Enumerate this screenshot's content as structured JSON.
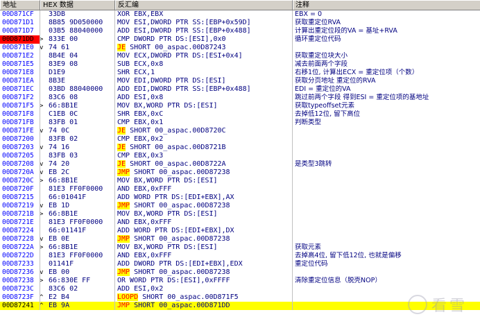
{
  "header": {
    "address": "地址",
    "hex": "HEX 数据",
    "disasm": "反汇编",
    "comment": "注释"
  },
  "watermark": "看雪",
  "colors": {
    "current_addr_bg": "#ff0000",
    "selected_bg": "#ffff00",
    "jump_highlight": "#ffff00",
    "jump_text": "#ff0000",
    "text": "#000080",
    "address": "#0000ff"
  },
  "rows": [
    {
      "addr": "00D871CF",
      "mark": "",
      "hex": "33DB",
      "mn": "",
      "ops": "XOR EBX,EBX",
      "cmt": "EBX = 0"
    },
    {
      "addr": "00D871D1",
      "mark": "",
      "hex": "8B85 9D050000",
      "mn": "",
      "ops": "MOV ESI,DWORD PTR SS:[EBP+0x59D]",
      "cmt": "获取重定位RVA"
    },
    {
      "addr": "00D871D7",
      "mark": "",
      "hex": "03B5 88040000",
      "mn": "",
      "ops": "ADD ESI,DWORD PTR SS:[EBP+0x488]",
      "cmt": "计算出重定位段的VA = 基址+RVA"
    },
    {
      "addr": "00D871DD",
      "mark": ">",
      "hex": "833E 00",
      "mn": "",
      "ops": "CMP DWORD PTR DS:[ESI],0x0",
      "cmt": "循环重定位代码"
    },
    {
      "addr": "00D871E0",
      "mark": "v",
      "hex": "74 61",
      "mn": "JE",
      "ops": "SHORT 00_aspac.00D87243",
      "cmt": ""
    },
    {
      "addr": "00D871E2",
      "mark": "",
      "hex": "8B4E 04",
      "mn": "",
      "ops": "MOV ECX,DWORD PTR DS:[ESI+0x4]",
      "cmt": "获取重定位块大小"
    },
    {
      "addr": "00D871E5",
      "mark": "",
      "hex": "83E9 08",
      "mn": "",
      "ops": "SUB ECX,0x8",
      "cmt": "减去前面两个字段"
    },
    {
      "addr": "00D871E8",
      "mark": "",
      "hex": "D1E9",
      "mn": "",
      "ops": "SHR ECX,1",
      "cmt": "右移1位, 计算出ECX = 重定位项（个数）"
    },
    {
      "addr": "00D871EA",
      "mark": "",
      "hex": "8B3E",
      "mn": "",
      "ops": "MOV EDI,DWORD PTR DS:[ESI]",
      "cmt": "获取分页地址  重定位的RVA"
    },
    {
      "addr": "00D871EC",
      "mark": "",
      "hex": "03BD 88040000",
      "mn": "",
      "ops": "ADD EDI,DWORD PTR SS:[EBP+0x488]",
      "cmt": "EDI = 重定位的VA"
    },
    {
      "addr": "00D871F2",
      "mark": "",
      "hex": "83C6 08",
      "mn": "",
      "ops": "ADD ESI,0x8",
      "cmt": "跳过前两个字段 得到ESI = 重定位项的基地址"
    },
    {
      "addr": "00D871F5",
      "mark": ">",
      "hex": "66:8B1E",
      "mn": "",
      "ops": "MOV BX,WORD PTR DS:[ESI]",
      "cmt": "获取typeoffset元素"
    },
    {
      "addr": "00D871F8",
      "mark": "",
      "hex": "C1EB 0C",
      "mn": "",
      "ops": "SHR EBX,0xC",
      "cmt": "去掉低12位, 留下高位"
    },
    {
      "addr": "00D871FB",
      "mark": "",
      "hex": "83FB 01",
      "mn": "",
      "ops": "CMP EBX,0x1",
      "cmt": "判断类型"
    },
    {
      "addr": "00D871FE",
      "mark": "v",
      "hex": "74 0C",
      "mn": "JE",
      "ops": "SHORT 00_aspac.00D8720C",
      "cmt": ""
    },
    {
      "addr": "00D87200",
      "mark": "",
      "hex": "83FB 02",
      "mn": "",
      "ops": "CMP EBX,0x2",
      "cmt": ""
    },
    {
      "addr": "00D87203",
      "mark": "v",
      "hex": "74 16",
      "mn": "JE",
      "ops": "SHORT 00_aspac.00D8721B",
      "cmt": ""
    },
    {
      "addr": "00D87205",
      "mark": "",
      "hex": "83FB 03",
      "mn": "",
      "ops": "CMP EBX,0x3",
      "cmt": ""
    },
    {
      "addr": "00D87208",
      "mark": "v",
      "hex": "74 20",
      "mn": "JE",
      "ops": "SHORT 00_aspac.00D8722A",
      "cmt": "是类型3跳转"
    },
    {
      "addr": "00D8720A",
      "mark": "v",
      "hex": "EB 2C",
      "mn": "JMP",
      "ops": "SHORT 00_aspac.00D87238",
      "cmt": ""
    },
    {
      "addr": "00D8720C",
      "mark": ">",
      "hex": "66:8B1E",
      "mn": "",
      "ops": "MOV BX,WORD PTR DS:[ESI]",
      "cmt": ""
    },
    {
      "addr": "00D8720F",
      "mark": "",
      "hex": "81E3 FF0F0000",
      "mn": "",
      "ops": "AND EBX,0xFFF",
      "cmt": ""
    },
    {
      "addr": "00D87215",
      "mark": "",
      "hex": "66:01041F",
      "mn": "",
      "ops": "ADD WORD PTR DS:[EDI+EBX],AX",
      "cmt": ""
    },
    {
      "addr": "00D87219",
      "mark": "v",
      "hex": "EB 1D",
      "mn": "JMP",
      "ops": "SHORT 00_aspac.00D87238",
      "cmt": ""
    },
    {
      "addr": "00D8721B",
      "mark": ">",
      "hex": "66:8B1E",
      "mn": "",
      "ops": "MOV BX,WORD PTR DS:[ESI]",
      "cmt": ""
    },
    {
      "addr": "00D8721E",
      "mark": "",
      "hex": "81E3 FF0F0000",
      "mn": "",
      "ops": "AND EBX,0xFFF",
      "cmt": ""
    },
    {
      "addr": "00D87224",
      "mark": "",
      "hex": "66:01141F",
      "mn": "",
      "ops": "ADD WORD PTR DS:[EDI+EBX],DX",
      "cmt": ""
    },
    {
      "addr": "00D87228",
      "mark": "v",
      "hex": "EB 0E",
      "mn": "JMP",
      "ops": "SHORT 00_aspac.00D87238",
      "cmt": ""
    },
    {
      "addr": "00D8722A",
      "mark": ">",
      "hex": "66:8B1E",
      "mn": "",
      "ops": "MOV BX,WORD PTR DS:[ESI]",
      "cmt": "获取元素"
    },
    {
      "addr": "00D8722D",
      "mark": "",
      "hex": "81E3 FF0F0000",
      "mn": "",
      "ops": "AND EBX,0xFFF",
      "cmt": "去掉高4位, 留下低12位, 也就是偏移"
    },
    {
      "addr": "00D87233",
      "mark": "",
      "hex": "01141F",
      "mn": "",
      "ops": "ADD DWORD PTR DS:[EDI+EBX],EDX",
      "cmt": "重定位代码"
    },
    {
      "addr": "00D87236",
      "mark": "v",
      "hex": "EB 00",
      "mn": "JMP",
      "ops": "SHORT 00_aspac.00D87238",
      "cmt": ""
    },
    {
      "addr": "00D87238",
      "mark": ">",
      "hex": "66:830E FF",
      "mn": "",
      "ops": "OR WORD PTR DS:[ESI],0xFFFF",
      "cmt": "清除重定位信息（脱壳NOP）"
    },
    {
      "addr": "00D8723C",
      "mark": "",
      "hex": "83C6 02",
      "mn": "",
      "ops": "ADD ESI,0x2",
      "cmt": ""
    },
    {
      "addr": "00D8723F",
      "mark": "^",
      "hex": "E2 B4",
      "mn": "LOOPD",
      "ops": "SHORT 00_aspac.00D871F5",
      "cmt": ""
    },
    {
      "addr": "00D87241",
      "mark": "^",
      "hex": "EB 9A",
      "mn": "JMP",
      "ops": "SHORT 00_aspac.00D871DD",
      "cmt": ""
    }
  ],
  "current_row": 3,
  "selected_row": 35
}
